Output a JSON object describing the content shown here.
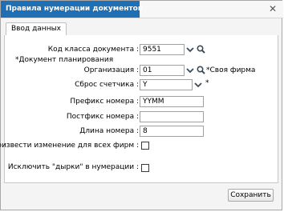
{
  "window": {
    "title": "Правила нумерации документов",
    "close_glyph": "✕"
  },
  "tabs": [
    {
      "label": "Ввод данных"
    }
  ],
  "form": {
    "class_code": {
      "label": "Код класса документа :",
      "value": "9551"
    },
    "planning_note": "*Документ планирования",
    "organization": {
      "label": "Организация :",
      "value": "01",
      "note": "*Своя фирма"
    },
    "counter_reset": {
      "label": "Сброс счетчика :",
      "value": "Y",
      "note": "*"
    },
    "prefix": {
      "label": "Префикс номера :",
      "value": "YYMM"
    },
    "postfix": {
      "label": "Постфикс номера :",
      "value": ""
    },
    "length": {
      "label": "Длина номера :",
      "value": "8"
    },
    "apply_all": {
      "label": "Произвести изменение для всех фирм :",
      "checked": false
    },
    "exclude_holes": {
      "label": "Исключить \"дырки\" в нумерации :",
      "checked": false
    }
  },
  "footer": {
    "save_label": "Сохранить"
  },
  "icons": {
    "chevron": "chevron-down-icon",
    "search": "search-icon",
    "close": "close-icon"
  },
  "colors": {
    "title_accent": "#1f6fb4",
    "icon_dark": "#3b4a57"
  }
}
